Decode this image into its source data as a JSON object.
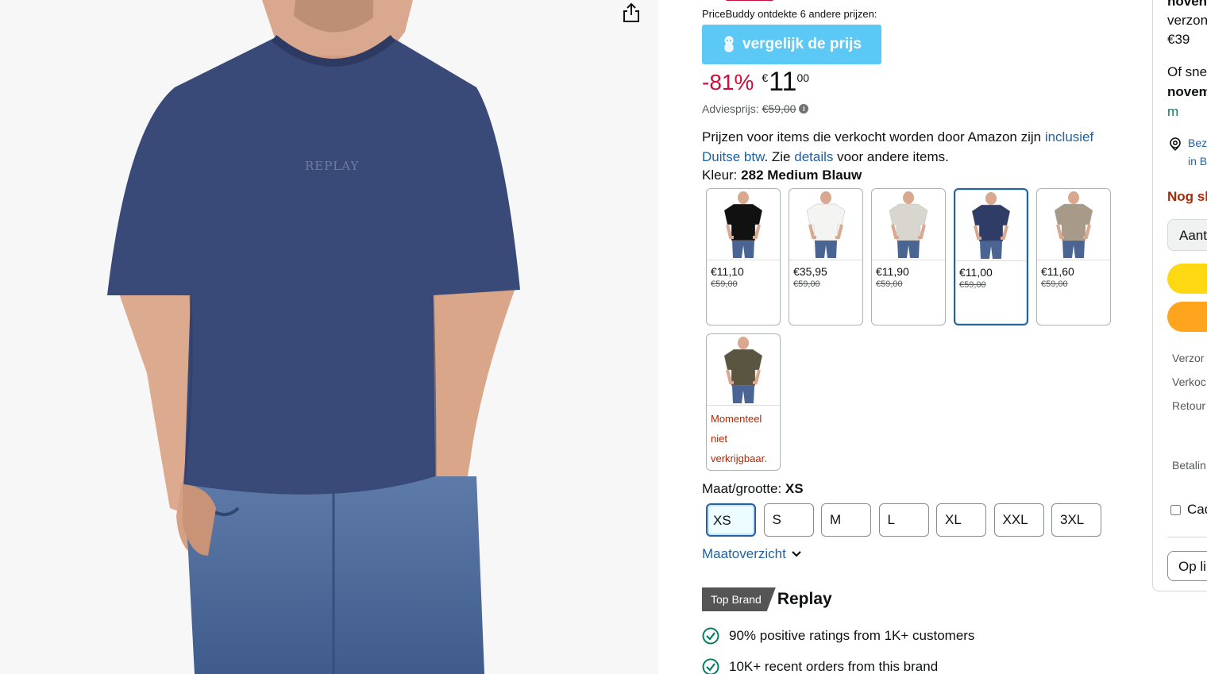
{
  "pricebuddy": {
    "text": "PriceBuddy ontdekte 6 andere prijzen:",
    "button_label": "vergelijk de prijs"
  },
  "price": {
    "discount": "-81%",
    "currency": "€",
    "whole": "11",
    "fraction": "00",
    "advies_label": "Adviesprijs:",
    "advies_value": "€59,00"
  },
  "vat": {
    "text1": "Prijzen voor items die verkocht worden door Amazon zijn ",
    "link1": "inclusief Duitse btw",
    "text2": ". Zie ",
    "link2": "details",
    "text3": " voor andere items."
  },
  "color": {
    "label": "Kleur:",
    "selected": "282 Medium Blauw",
    "swatches": [
      {
        "price": "€11,10",
        "orig": "€59,00",
        "shirt_color": "#111111"
      },
      {
        "price": "€35,95",
        "orig": "€59,00",
        "shirt_color": "#f4f4f2"
      },
      {
        "price": "€11,90",
        "orig": "€59,00",
        "shirt_color": "#d9d6cf"
      },
      {
        "price": "€11,00",
        "orig": "€59,00",
        "shirt_color": "#2f3d66"
      },
      {
        "price": "€11,60",
        "orig": "€59,00",
        "shirt_color": "#a89a88"
      },
      {
        "unavailable": "Momenteel niet verkrijgbaar.",
        "shirt_color": "#5a5540"
      }
    ]
  },
  "size": {
    "label": "Maat/grootte:",
    "selected": "XS",
    "options": [
      "XS",
      "S",
      "M",
      "L",
      "XL",
      "XXL",
      "3XL"
    ],
    "chart_link": "Maatoverzicht"
  },
  "brand": {
    "badge": "Top Brand",
    "name": "Replay",
    "facts": [
      "90% positive ratings from 1K+ customers",
      "10K+ recent orders from this brand"
    ]
  },
  "product_image": {
    "shirt_print": "REPLAY",
    "shirt_color": "#3a4a78"
  },
  "buybox": {
    "line1": "noven",
    "line2": "verzon",
    "line3": "€39",
    "line4": "Of sne",
    "line5": "novem",
    "line6": "m",
    "location_line1": "Bez",
    "location_line2": "in B",
    "stock": "Nog sl",
    "qty": "Aant",
    "row_verzonden": "Verzor",
    "row_verkocht": "Verkoc",
    "row_retour": "Retour",
    "row_betaling": "Betalin",
    "cadeau": "Cad",
    "oplist": "Op li"
  },
  "colors": {
    "link": "#2162a1",
    "discount": "#cc0c39",
    "pricebuddy": "#5bc8f5",
    "add_to_cart": "#ffd814",
    "buy_now": "#ffa41c",
    "check": "#067d62"
  }
}
